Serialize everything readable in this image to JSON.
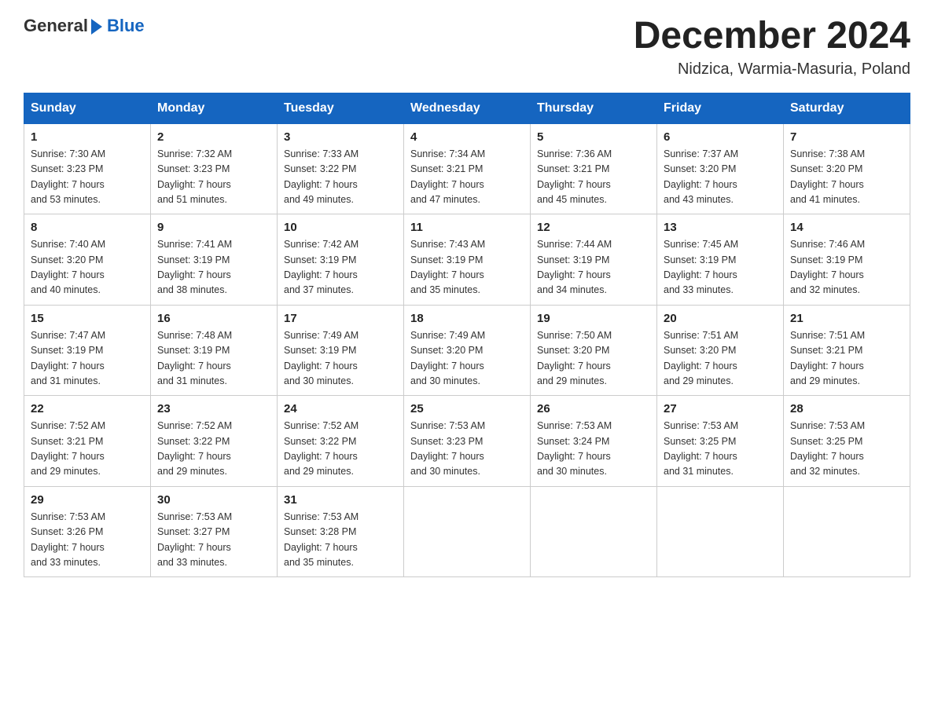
{
  "header": {
    "logo_general": "General",
    "logo_blue": "Blue",
    "month_year": "December 2024",
    "location": "Nidzica, Warmia-Masuria, Poland"
  },
  "days_of_week": [
    "Sunday",
    "Monday",
    "Tuesday",
    "Wednesday",
    "Thursday",
    "Friday",
    "Saturday"
  ],
  "weeks": [
    [
      {
        "day": "1",
        "sunrise": "7:30 AM",
        "sunset": "3:23 PM",
        "daylight": "7 hours and 53 minutes."
      },
      {
        "day": "2",
        "sunrise": "7:32 AM",
        "sunset": "3:23 PM",
        "daylight": "7 hours and 51 minutes."
      },
      {
        "day": "3",
        "sunrise": "7:33 AM",
        "sunset": "3:22 PM",
        "daylight": "7 hours and 49 minutes."
      },
      {
        "day": "4",
        "sunrise": "7:34 AM",
        "sunset": "3:21 PM",
        "daylight": "7 hours and 47 minutes."
      },
      {
        "day": "5",
        "sunrise": "7:36 AM",
        "sunset": "3:21 PM",
        "daylight": "7 hours and 45 minutes."
      },
      {
        "day": "6",
        "sunrise": "7:37 AM",
        "sunset": "3:20 PM",
        "daylight": "7 hours and 43 minutes."
      },
      {
        "day": "7",
        "sunrise": "7:38 AM",
        "sunset": "3:20 PM",
        "daylight": "7 hours and 41 minutes."
      }
    ],
    [
      {
        "day": "8",
        "sunrise": "7:40 AM",
        "sunset": "3:20 PM",
        "daylight": "7 hours and 40 minutes."
      },
      {
        "day": "9",
        "sunrise": "7:41 AM",
        "sunset": "3:19 PM",
        "daylight": "7 hours and 38 minutes."
      },
      {
        "day": "10",
        "sunrise": "7:42 AM",
        "sunset": "3:19 PM",
        "daylight": "7 hours and 37 minutes."
      },
      {
        "day": "11",
        "sunrise": "7:43 AM",
        "sunset": "3:19 PM",
        "daylight": "7 hours and 35 minutes."
      },
      {
        "day": "12",
        "sunrise": "7:44 AM",
        "sunset": "3:19 PM",
        "daylight": "7 hours and 34 minutes."
      },
      {
        "day": "13",
        "sunrise": "7:45 AM",
        "sunset": "3:19 PM",
        "daylight": "7 hours and 33 minutes."
      },
      {
        "day": "14",
        "sunrise": "7:46 AM",
        "sunset": "3:19 PM",
        "daylight": "7 hours and 32 minutes."
      }
    ],
    [
      {
        "day": "15",
        "sunrise": "7:47 AM",
        "sunset": "3:19 PM",
        "daylight": "7 hours and 31 minutes."
      },
      {
        "day": "16",
        "sunrise": "7:48 AM",
        "sunset": "3:19 PM",
        "daylight": "7 hours and 31 minutes."
      },
      {
        "day": "17",
        "sunrise": "7:49 AM",
        "sunset": "3:19 PM",
        "daylight": "7 hours and 30 minutes."
      },
      {
        "day": "18",
        "sunrise": "7:49 AM",
        "sunset": "3:20 PM",
        "daylight": "7 hours and 30 minutes."
      },
      {
        "day": "19",
        "sunrise": "7:50 AM",
        "sunset": "3:20 PM",
        "daylight": "7 hours and 29 minutes."
      },
      {
        "day": "20",
        "sunrise": "7:51 AM",
        "sunset": "3:20 PM",
        "daylight": "7 hours and 29 minutes."
      },
      {
        "day": "21",
        "sunrise": "7:51 AM",
        "sunset": "3:21 PM",
        "daylight": "7 hours and 29 minutes."
      }
    ],
    [
      {
        "day": "22",
        "sunrise": "7:52 AM",
        "sunset": "3:21 PM",
        "daylight": "7 hours and 29 minutes."
      },
      {
        "day": "23",
        "sunrise": "7:52 AM",
        "sunset": "3:22 PM",
        "daylight": "7 hours and 29 minutes."
      },
      {
        "day": "24",
        "sunrise": "7:52 AM",
        "sunset": "3:22 PM",
        "daylight": "7 hours and 29 minutes."
      },
      {
        "day": "25",
        "sunrise": "7:53 AM",
        "sunset": "3:23 PM",
        "daylight": "7 hours and 30 minutes."
      },
      {
        "day": "26",
        "sunrise": "7:53 AM",
        "sunset": "3:24 PM",
        "daylight": "7 hours and 30 minutes."
      },
      {
        "day": "27",
        "sunrise": "7:53 AM",
        "sunset": "3:25 PM",
        "daylight": "7 hours and 31 minutes."
      },
      {
        "day": "28",
        "sunrise": "7:53 AM",
        "sunset": "3:25 PM",
        "daylight": "7 hours and 32 minutes."
      }
    ],
    [
      {
        "day": "29",
        "sunrise": "7:53 AM",
        "sunset": "3:26 PM",
        "daylight": "7 hours and 33 minutes."
      },
      {
        "day": "30",
        "sunrise": "7:53 AM",
        "sunset": "3:27 PM",
        "daylight": "7 hours and 33 minutes."
      },
      {
        "day": "31",
        "sunrise": "7:53 AM",
        "sunset": "3:28 PM",
        "daylight": "7 hours and 35 minutes."
      },
      null,
      null,
      null,
      null
    ]
  ],
  "labels": {
    "sunrise": "Sunrise:",
    "sunset": "Sunset:",
    "daylight": "Daylight:"
  }
}
